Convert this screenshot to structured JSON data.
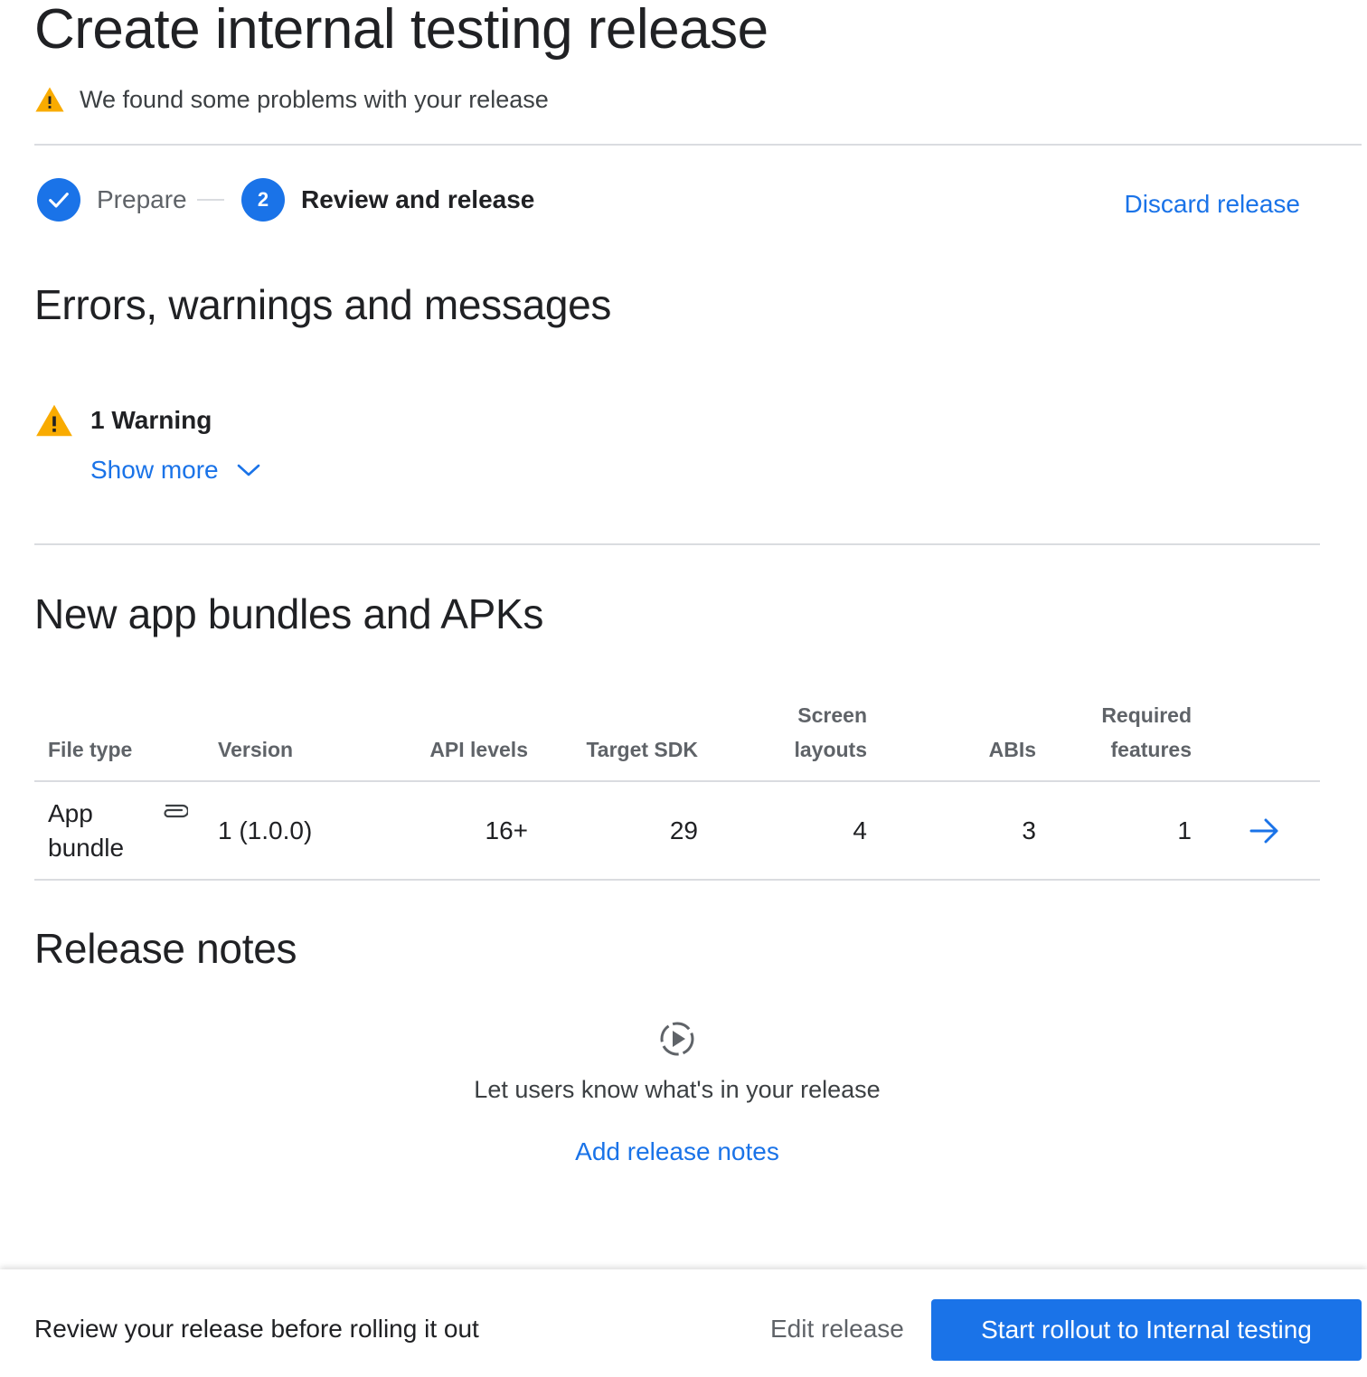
{
  "page": {
    "title": "Create internal testing release",
    "alert": "We found some problems with your release"
  },
  "stepper": {
    "steps": [
      {
        "label": "Prepare",
        "state": "done"
      },
      {
        "number": "2",
        "label": "Review and release",
        "state": "active"
      }
    ],
    "discard_label": "Discard release"
  },
  "messages": {
    "heading": "Errors, warnings and messages",
    "warning_count_label": "1 Warning",
    "show_more_label": "Show more"
  },
  "bundles": {
    "heading": "New app bundles and APKs",
    "columns": {
      "file_type": "File type",
      "version": "Version",
      "api_levels": "API levels",
      "target_sdk": "Target SDK",
      "screen_layouts_1": "Screen",
      "screen_layouts_2": "layouts",
      "abis": "ABIs",
      "required_features_1": "Required",
      "required_features_2": "features"
    },
    "rows": [
      {
        "file_type_1": "App",
        "file_type_2": "bundle",
        "version": "1 (1.0.0)",
        "api_levels": "16+",
        "target_sdk": "29",
        "screen_layouts": "4",
        "abis": "3",
        "required_features": "1"
      }
    ]
  },
  "release_notes": {
    "heading": "Release notes",
    "empty_text": "Let users know what's in your release",
    "add_label": "Add release notes"
  },
  "footer": {
    "text": "Review your release before rolling it out",
    "edit_label": "Edit release",
    "primary_label": "Start rollout to Internal testing"
  },
  "colors": {
    "accent": "#1a73e8",
    "warning": "#f9ab00",
    "divider": "#dadce0"
  }
}
